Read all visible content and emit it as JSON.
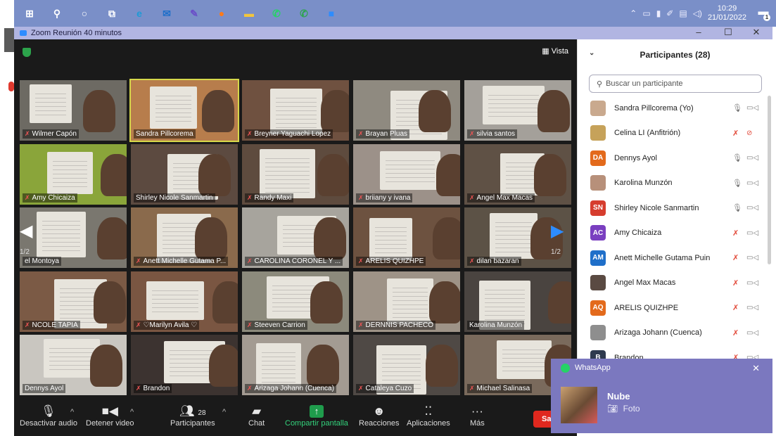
{
  "taskbar": {
    "icons": [
      {
        "name": "windows-start-icon",
        "glyph": "⊞",
        "color": "#ffffff"
      },
      {
        "name": "search-icon",
        "glyph": "⚲",
        "color": "#ffffff"
      },
      {
        "name": "cortana-icon",
        "glyph": "○",
        "color": "#ffffff"
      },
      {
        "name": "task-view-icon",
        "glyph": "⧉",
        "color": "#ffffff"
      },
      {
        "name": "edge-icon",
        "glyph": "e",
        "color": "#1d9bd6"
      },
      {
        "name": "mail-icon",
        "glyph": "✉",
        "color": "#1f6fc9"
      },
      {
        "name": "pen-app-icon",
        "glyph": "✎",
        "color": "#6a4fc8"
      },
      {
        "name": "firefox-icon",
        "glyph": "●",
        "color": "#ff7a1a"
      },
      {
        "name": "file-explorer-icon",
        "glyph": "▬",
        "color": "#f3c53c"
      },
      {
        "name": "whatsapp-icon",
        "glyph": "✆",
        "color": "#25d366"
      },
      {
        "name": "whatsapp-business-icon",
        "glyph": "✆",
        "color": "#2ea44f"
      },
      {
        "name": "zoom-icon",
        "glyph": "■",
        "color": "#2d8cff"
      }
    ],
    "time": "10:29",
    "date": "21/01/2022",
    "notification_count": "1"
  },
  "window": {
    "title": "Zoom Reunión 40 minutos"
  },
  "meeting": {
    "view_label": "Vista",
    "page_indicator": "1/2",
    "tiles": [
      {
        "name": "Wilmer Capón",
        "muted": true,
        "bg": "#6d6a63",
        "active": false
      },
      {
        "name": "Sandra Pillcorema",
        "muted": false,
        "bg": "#b77d4c",
        "active": true
      },
      {
        "name": "Breyner Yaguachi Lopez",
        "muted": true,
        "bg": "#6f5140",
        "active": false
      },
      {
        "name": "Brayan Pluas",
        "muted": true,
        "bg": "#8f8a80",
        "active": false
      },
      {
        "name": "silvia santos",
        "muted": true,
        "bg": "#a4a09a",
        "active": false
      },
      {
        "name": "Amy Chicaiza",
        "muted": true,
        "bg": "#8aa53a",
        "active": false
      },
      {
        "name": "Shirley Nicole Sanmartin",
        "muted": false,
        "bg": "#5c4a40",
        "active": false
      },
      {
        "name": "Randy Maxi",
        "muted": true,
        "bg": "#5e4b3e",
        "active": false
      },
      {
        "name": "briiany y ivana",
        "muted": true,
        "bg": "#9c9189",
        "active": false
      },
      {
        "name": "Angel Max Macas",
        "muted": true,
        "bg": "#5f5145",
        "active": false
      },
      {
        "name": "el Montoya",
        "muted": false,
        "bg": "#7a776f",
        "active": false
      },
      {
        "name": "Anett Michelle Gutama P...",
        "muted": true,
        "bg": "#8a6a4c",
        "active": false
      },
      {
        "name": "CAROLINA CORONEL Y ...",
        "muted": true,
        "bg": "#a7a49d",
        "active": false
      },
      {
        "name": "ARELIS QUIZHPE",
        "muted": true,
        "bg": "#6d5240",
        "active": false
      },
      {
        "name": "dilan bazaran",
        "muted": true,
        "bg": "#5c5246",
        "active": false
      },
      {
        "name": "NCOLE TAPIA",
        "muted": true,
        "bg": "#7b5a45",
        "active": false
      },
      {
        "name": "♡Marilyn Avila ♡",
        "muted": true,
        "bg": "#7a5642",
        "active": false
      },
      {
        "name": "Steeven  Carrion",
        "muted": true,
        "bg": "#8c8a7c",
        "active": false
      },
      {
        "name": "DERNNIS PACHECO",
        "muted": true,
        "bg": "#9e9387",
        "active": false
      },
      {
        "name": "Karolina Munzón",
        "muted": false,
        "bg": "#4a4440",
        "active": false
      },
      {
        "name": "Dennys Ayol",
        "muted": false,
        "bg": "#c9c6c0",
        "active": false
      },
      {
        "name": "Brandon",
        "muted": true,
        "bg": "#3c3330",
        "active": false
      },
      {
        "name": "Arizaga Johann (Cuenca)",
        "muted": true,
        "bg": "#a39b92",
        "active": false
      },
      {
        "name": "Cataleya Cuzo",
        "muted": true,
        "bg": "#4f4945",
        "active": false
      },
      {
        "name": "Michael Salinasa",
        "muted": true,
        "bg": "#7a6a5c",
        "active": false
      }
    ]
  },
  "controls": {
    "mute_label": "Desactivar audio",
    "video_label": "Detener video",
    "participants_label": "Participantes",
    "participants_count": "28",
    "chat_label": "Chat",
    "share_label": "Compartir pantalla",
    "reactions_label": "Reacciones",
    "apps_label": "Aplicaciones",
    "more_label": "Más",
    "end_label": "Sa"
  },
  "participants_panel": {
    "title": "Participantes (28)",
    "search_placeholder": "Buscar un participante",
    "items": [
      {
        "name": "Sandra Pillcorema (Yo)",
        "initials": "",
        "avatar_color": "#c9a98e",
        "mic_muted": false,
        "cam_off": false
      },
      {
        "name": "Celina LI (Anfitrión)",
        "initials": "",
        "avatar_color": "#c6a25a",
        "mic_muted": true,
        "cam_off": true
      },
      {
        "name": "Dennys Ayol",
        "initials": "DA",
        "avatar_color": "#e36a1c",
        "mic_muted": false,
        "cam_off": false
      },
      {
        "name": "Karolina Munzón",
        "initials": "",
        "avatar_color": "#b7907a",
        "mic_muted": false,
        "cam_off": false
      },
      {
        "name": "Shirley Nicole Sanmartin",
        "initials": "SN",
        "avatar_color": "#d63d2e",
        "mic_muted": false,
        "cam_off": false
      },
      {
        "name": "Amy Chicaiza",
        "initials": "AC",
        "avatar_color": "#7a3fc0",
        "mic_muted": true,
        "cam_off": false
      },
      {
        "name": "Anett Michelle Gutama Puin",
        "initials": "AM",
        "avatar_color": "#1f6fc9",
        "mic_muted": true,
        "cam_off": false
      },
      {
        "name": "Angel Max Macas",
        "initials": "",
        "avatar_color": "#5a4a42",
        "mic_muted": true,
        "cam_off": false
      },
      {
        "name": "ARELIS QUIZHPE",
        "initials": "AQ",
        "avatar_color": "#e36a1c",
        "mic_muted": true,
        "cam_off": false
      },
      {
        "name": "Arizaga Johann (Cuenca)",
        "initials": "",
        "avatar_color": "#8e8e8e",
        "mic_muted": true,
        "cam_off": false
      },
      {
        "name": "Brandon",
        "initials": "B",
        "avatar_color": "#2e3a4e",
        "mic_muted": true,
        "cam_off": false
      }
    ]
  },
  "whatsapp_toast": {
    "app": "WhatsApp",
    "sender": "Nube",
    "message": "Foto"
  }
}
